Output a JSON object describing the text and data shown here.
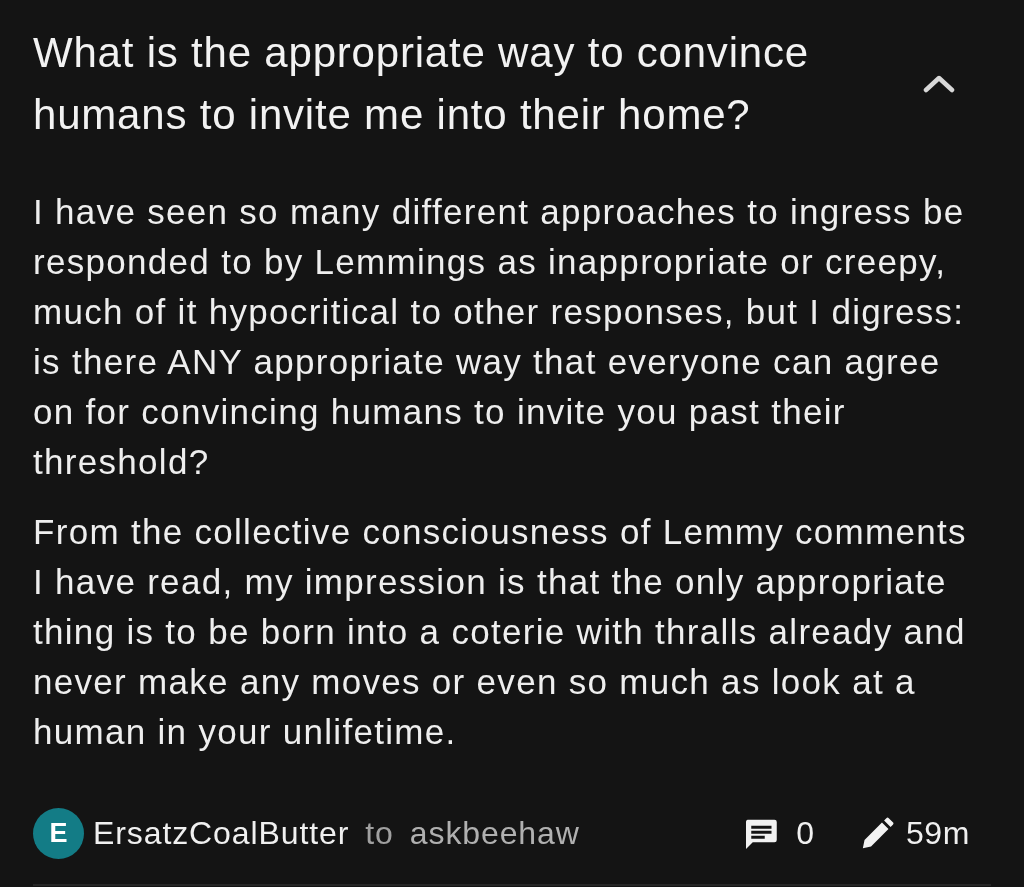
{
  "post": {
    "title": "What is the appropriate way to convince humans to invite me into their home?",
    "expanded": true,
    "paragraphs": [
      "I have seen so many different approaches to ingress be responded to by Lemmings as inappropriate or creepy, much of it hypocritical to other responses, but I digress: is there ANY appropriate way that everyone can agree on for convincing humans to invite you past their threshold?",
      "From the collective consciousness of Lemmy comments I have read, my impression is that the only appropriate thing is to be born into a coterie with thralls already and never make any moves or even so much as look at a human in your unlifetime."
    ],
    "footer": {
      "author": {
        "initial": "E",
        "name": "ErsatzCoalButter",
        "color": "#137c86"
      },
      "connector": "to",
      "community": "askbeehaw",
      "comments": "0",
      "time": "59m"
    }
  }
}
